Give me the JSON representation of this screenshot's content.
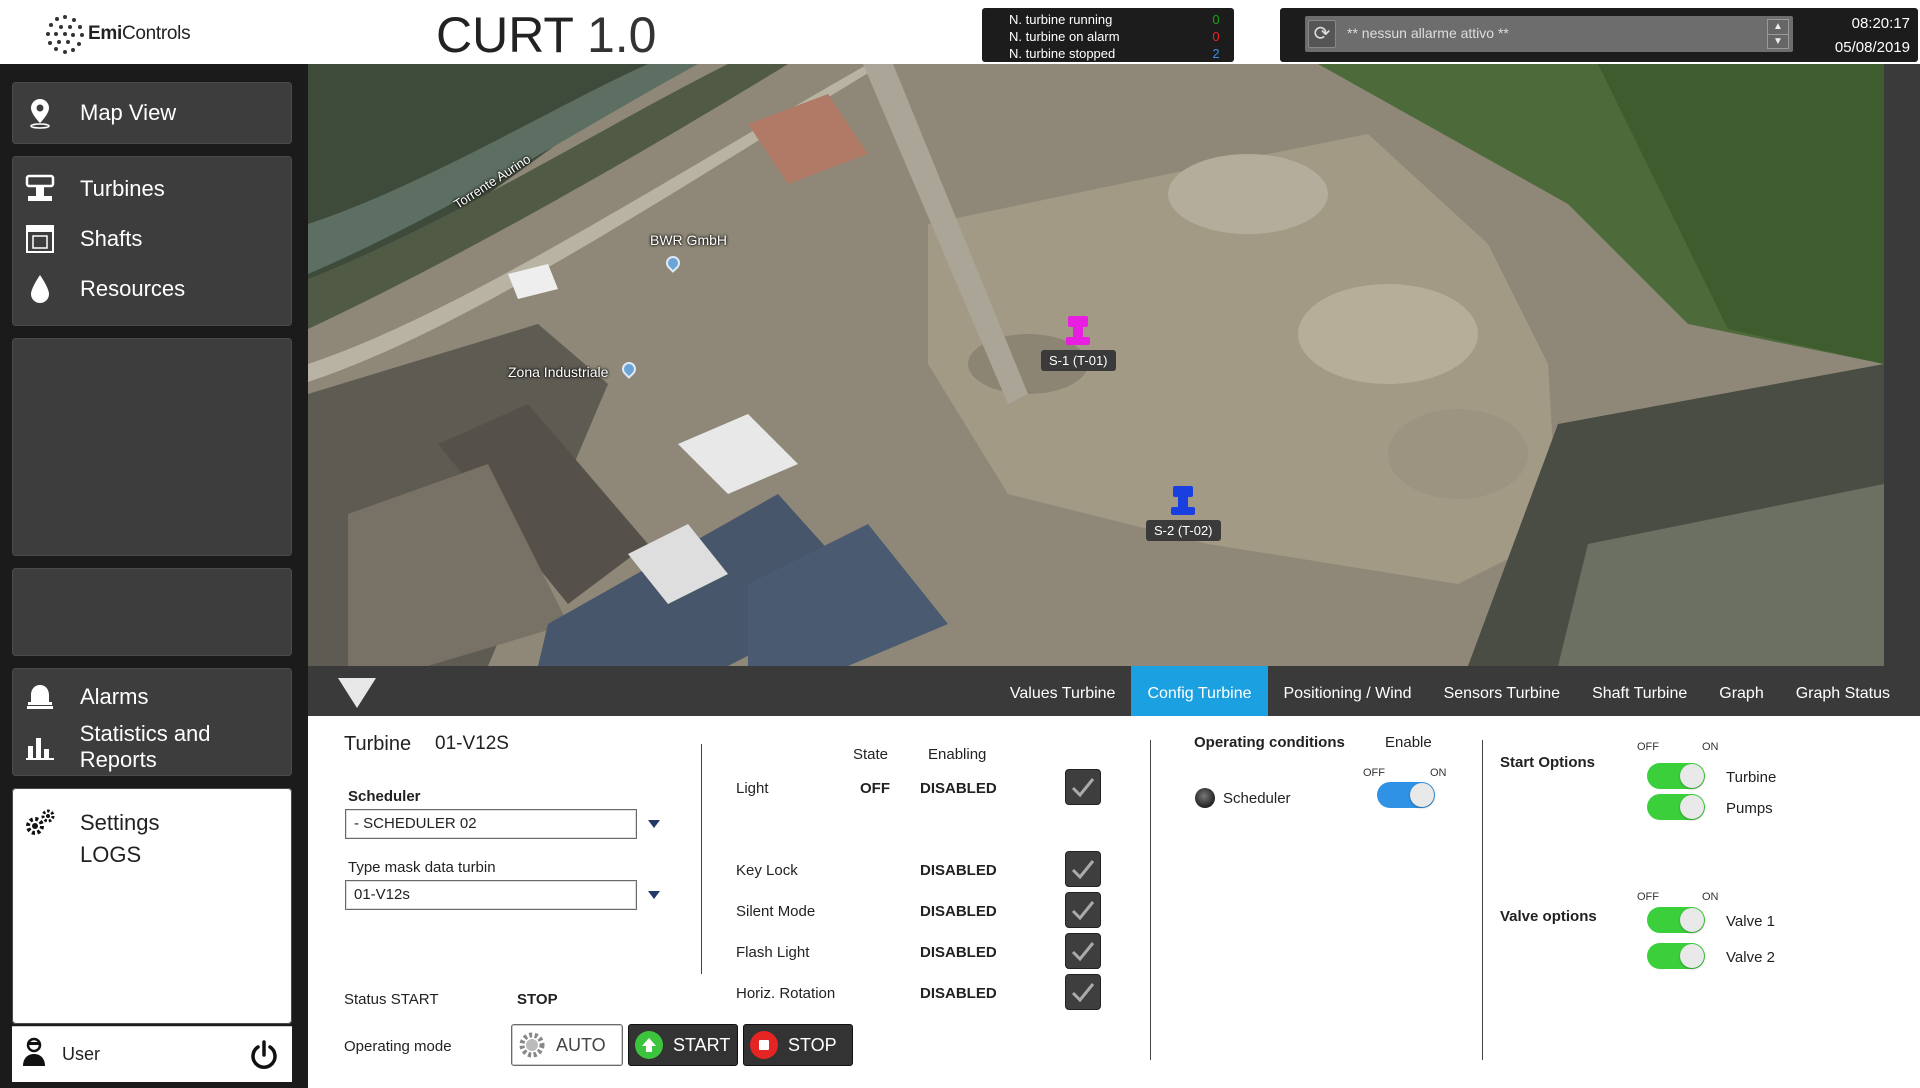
{
  "header": {
    "logo_text_bold": "Emi",
    "logo_text": "Controls",
    "app_title": "CURT",
    "app_version": "1.0",
    "stats": [
      {
        "label": "N. turbine running",
        "value": "0",
        "color": "#1aa31a"
      },
      {
        "label": "N. turbine on alarm",
        "value": "0",
        "color": "#ee2222"
      },
      {
        "label": "N. turbine stopped",
        "value": "2",
        "color": "#3a8fe8"
      }
    ],
    "alarm_text": "** nessun allarme attivo **",
    "time": "08:20:17",
    "date": "05/08/2019"
  },
  "sidebar": {
    "map_view": "Map View",
    "turbines": "Turbines",
    "shafts": "Shafts",
    "resources": "Resources",
    "alarms": "Alarms",
    "statistics": "Statistics and Reports",
    "settings": "Settings",
    "logs": "LOGS",
    "user": "User"
  },
  "map": {
    "river_label": "Torrente Aurino",
    "place1": "BWR GmbH",
    "place2": "Zona Industriale",
    "markers": [
      {
        "label": "S-1 (T-01)",
        "color": "#e81ee0"
      },
      {
        "label": "S-2 (T-02)",
        "color": "#1a3fe0"
      }
    ]
  },
  "tabs": [
    "Values Turbine",
    "Config Turbine",
    "Positioning / Wind",
    "Sensors Turbine",
    "Shaft Turbine",
    "Graph",
    "Graph Status"
  ],
  "active_tab": "Config Turbine",
  "config": {
    "turbine_label": "Turbine",
    "turbine_id": "01-V12S",
    "scheduler_label": "Scheduler",
    "scheduler_value": "- SCHEDULER 02",
    "mask_label": "Type mask data turbin",
    "mask_value": "01-V12s",
    "status_label": "Status START",
    "status_value": "STOP",
    "operating_mode_label": "Operating mode",
    "btn_auto": "AUTO",
    "btn_start": "START",
    "btn_stop": "STOP",
    "state_header": "State",
    "enabling_header": "Enabling",
    "features": [
      {
        "name": "Light",
        "state": "OFF",
        "enabling": "DISABLED"
      },
      {
        "name": "Key Lock",
        "state": "",
        "enabling": "DISABLED"
      },
      {
        "name": "Silent Mode",
        "state": "",
        "enabling": "DISABLED"
      },
      {
        "name": "Flash Light",
        "state": "",
        "enabling": "DISABLED"
      },
      {
        "name": "Horiz. Rotation",
        "state": "",
        "enabling": "DISABLED"
      }
    ],
    "operating_conditions": "Operating conditions",
    "enable_label": "Enable",
    "scheduler_cond": "Scheduler",
    "off": "OFF",
    "on": "ON",
    "start_options": "Start Options",
    "start_turbine": "Turbine",
    "start_pumps": "Pumps",
    "valve_options": "Valve options",
    "valve1": "Valve 1",
    "valve2": "Valve 2"
  }
}
